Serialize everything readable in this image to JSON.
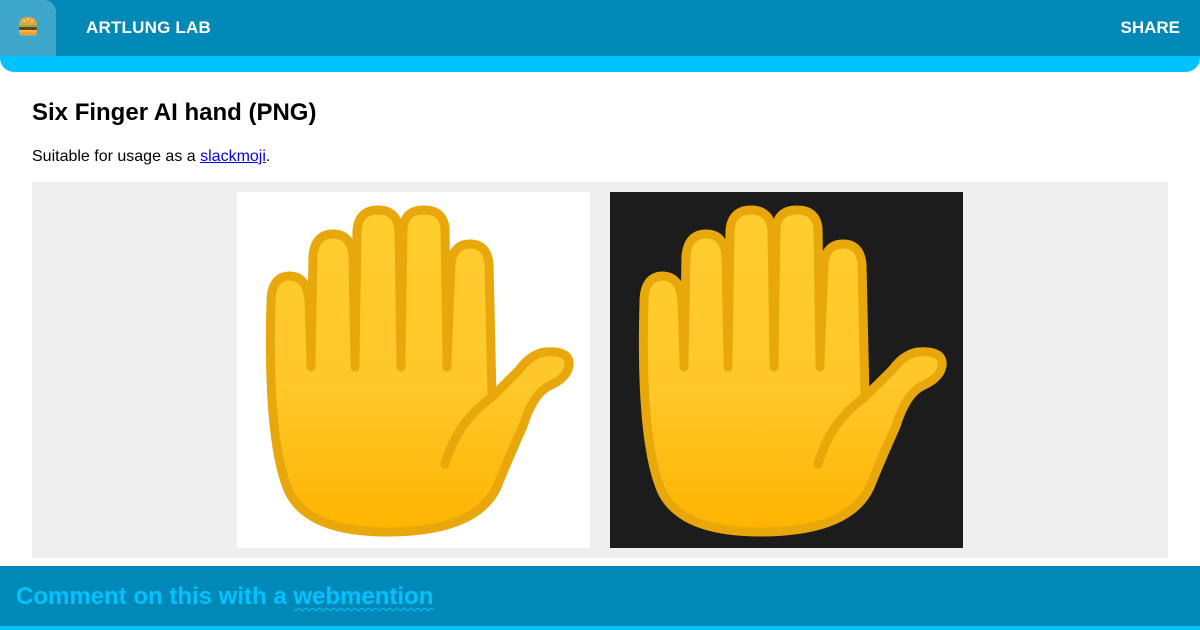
{
  "header": {
    "logo_icon": "burger-icon",
    "logo_glyph": "🍔",
    "site_name": "ARTLUNG LAB",
    "share_label": "SHARE"
  },
  "main": {
    "title": "Six Finger AI hand (PNG)",
    "intro_prefix": "Suitable for usage as a ",
    "intro_link": "slackmoji",
    "intro_suffix": ".",
    "images": [
      {
        "icon": "six-finger-hand-icon",
        "background": "light"
      },
      {
        "icon": "six-finger-hand-icon",
        "background": "dark"
      }
    ]
  },
  "footer": {
    "prefix": "Comment on this with a ",
    "link": "webmention"
  },
  "colors": {
    "header_bg": "#0089b6",
    "header_accent": "#00c2ff",
    "gallery_bg": "#efefef",
    "hand_fill": "#ffc21a",
    "hand_outline": "#e8a70a",
    "dark_image_bg": "#1c1c1c"
  }
}
